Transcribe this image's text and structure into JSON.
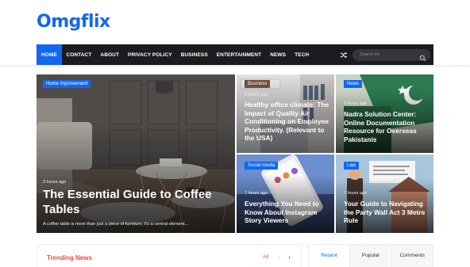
{
  "site": {
    "logo": "Omgflix",
    "brand_color": "#1167f2"
  },
  "nav": {
    "items": [
      "HOME",
      "CONTACT",
      "ABOUT",
      "PRIVACY POLICY",
      "BUSINESS",
      "ENTERTAINMENT",
      "NEWS",
      "TECH"
    ],
    "active_index": 0,
    "shuffle_icon": "shuffle-icon",
    "search": {
      "placeholder": "Search for",
      "icon": "search-icon"
    }
  },
  "featured": [
    {
      "category": "Home improvement",
      "category_color": "#1167f2",
      "time": "3 hours ago",
      "title": "The Essential Guide to Coffee Tables",
      "excerpt": "A coffee table is more than just a piece of furniture; it's a central element..."
    },
    {
      "category": "Business",
      "category_color": "#6d4f3c",
      "time": "6 hours ago",
      "title": "Healthy office climate: The Impact of Quality Air Conditioning on Employee Productivity. (Relevant to the USA)"
    },
    {
      "category": "News",
      "category_color": "#1167f2",
      "time": "6 hours ago",
      "title": "Nadra Solution Center: Online Documentation Resource for Overseas Pakistanis"
    },
    {
      "category": "Social media",
      "category_color": "#1167f2",
      "time": "7 hours ago",
      "title": "Everything You Need to Know About Instagram Story Viewers"
    },
    {
      "category": "Law",
      "category_color": "#1167f2",
      "time": "7 hours ago",
      "title": "Your Guide to Navigating the Party Wall Act 3 Metre Rule"
    }
  ],
  "trending": {
    "title": "Trending News",
    "all_label": "All",
    "prev": "‹",
    "next": "›"
  },
  "sidebar_tabs": {
    "items": [
      "Recent",
      "Popular",
      "Comments"
    ],
    "active_index": 0
  }
}
